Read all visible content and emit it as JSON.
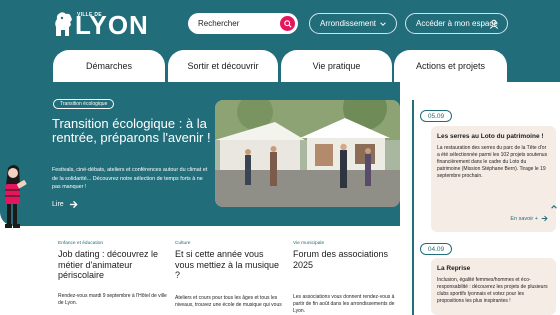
{
  "colors": {
    "primary": "#226d7a",
    "accent": "#e4165d",
    "card": "#f5ece6"
  },
  "logo": {
    "prefix": "VILLE DE",
    "word": "LYON"
  },
  "search": {
    "placeholder": "Rechercher",
    "icon": "search-icon"
  },
  "header": {
    "arrondissement": "Arrondissement",
    "account": "Accéder à mon espace"
  },
  "nav": [
    "Démarches",
    "Sortir et découvrir",
    "Vie pratique",
    "Actions et projets"
  ],
  "hero": {
    "tag": "Transition écologique",
    "title": "Transition écologique : à la rentrée, préparons l'avenir !",
    "description": "Festivals, ciné-débats, ateliers et conférences autour du climat et de la solidarité... Découvrez notre sélection de temps forts à ne pas manquer !",
    "link": "Lire"
  },
  "agenda": [
    {
      "date": "05.09",
      "title": "Les serres au Loto du patrimoine !",
      "description": "La restauration des serres du parc de la Tête d'or a été sélectionnée parmi les 102 projets soutenus financièrement dans le cadre du Loto du patrimoine (Mission Stéphane Bern). Tirage le 19 septembre prochain.",
      "link": "En savoir +"
    },
    {
      "date": "04.09",
      "title": "La Reprise",
      "description": "Inclusion, égalité femmes/hommes et éco-responsabilité : découvrez les projets de plusieurs clubs sportifs lyonnais et votez pour les propositions les plus inspirantes !"
    }
  ],
  "news": [
    {
      "category": "Enfance et éducation",
      "title": "Job dating : découvrez le métier d'animateur périscolaire",
      "description": "Rendez-vous mardi 9 septembre à l'Hôtel de ville de Lyon."
    },
    {
      "category": "Culture",
      "title": "Et si cette année vous vous mettiez à la musique ?",
      "description": "Ateliers et cours pour tous les âges et tous les niveaux, trouvez une école de musique qui vous"
    },
    {
      "category": "Vie municipale",
      "title": "Forum des associations 2025",
      "description": "Les associations vous donnent rendez-vous à partir de fin août dans les arrondissements de Lyon."
    }
  ]
}
